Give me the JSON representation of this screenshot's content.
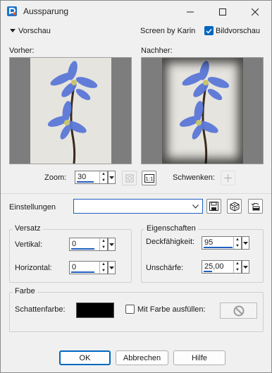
{
  "window": {
    "title": "Aussparung"
  },
  "preview": {
    "toggle_label": "Vorschau",
    "credit": "Screen by Karin",
    "image_preview_label": "Bildvorschau",
    "image_preview_checked": true,
    "before_label": "Vorher:",
    "after_label": "Nachher:"
  },
  "zoom": {
    "label": "Zoom:",
    "value": "30",
    "pan_label": "Schwenken:"
  },
  "settings": {
    "label": "Einstellungen",
    "value": ""
  },
  "versatz": {
    "title": "Versatz",
    "vertical_label": "Vertikal:",
    "vertical_value": "0",
    "horizontal_label": "Horizontal:",
    "horizontal_value": "0"
  },
  "eigenschaften": {
    "title": "Eigenschaften",
    "opacity_label": "Deckfähigkeit:",
    "opacity_value": "95",
    "blur_label": "Unschärfe:",
    "blur_value": "25,00"
  },
  "farbe": {
    "title": "Farbe",
    "shadow_label": "Schattenfarbe:",
    "shadow_color": "#000000",
    "fill_label": "Mit Farbe ausfüllen:",
    "fill_checked": false
  },
  "buttons": {
    "ok": "OK",
    "cancel": "Abbrechen",
    "help": "Hilfe"
  },
  "colors": {
    "accent": "#0067c0",
    "preview_bg": "#7d7d7d"
  }
}
